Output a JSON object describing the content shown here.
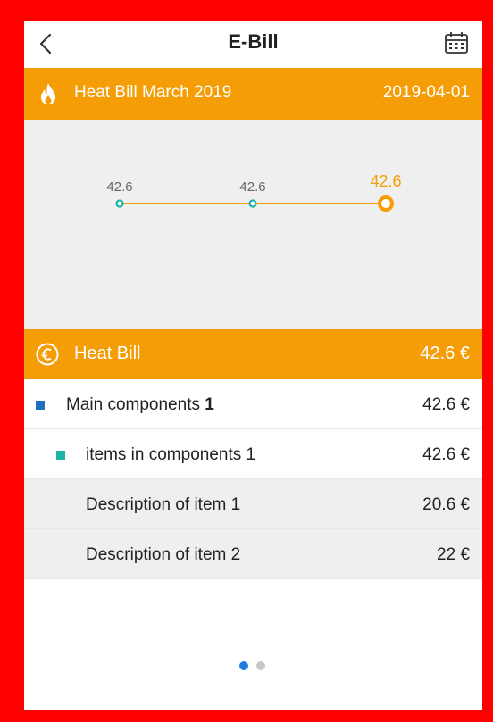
{
  "header": {
    "title": "E-Bill",
    "back_icon": "back-arrow-icon",
    "calendar_icon": "calendar-icon"
  },
  "bill_bar": {
    "title": "Heat Bill March 2019",
    "date": "2019-04-01",
    "icon": "flame-icon",
    "color": "#f59d06"
  },
  "chart_data": {
    "type": "line",
    "categories": [
      "",
      "",
      ""
    ],
    "series": [
      {
        "values": [
          42.6,
          42.6,
          42.6
        ]
      }
    ],
    "data_labels": [
      "42.6",
      "42.6",
      "42.6"
    ],
    "highlight_index": 2,
    "colors": {
      "line": "#f59d06",
      "point": "#1ab3a6",
      "highlight": "#f59d06"
    },
    "title": "",
    "xlabel": "",
    "ylabel": ""
  },
  "heat_section": {
    "title": "Heat Bill",
    "total": "42.6 €",
    "icon": "euro-circle-icon"
  },
  "rows": [
    {
      "label_prefix": "Main components ",
      "label_bold": "1",
      "value": "42.6 €"
    },
    {
      "label": "items in components 1",
      "value": "42.6 €"
    },
    {
      "label": "Description of item 1",
      "value": "20.6 €"
    },
    {
      "label": "Description of item 2",
      "value": "22 €"
    }
  ],
  "pager": {
    "pages": 2,
    "active": 1
  }
}
